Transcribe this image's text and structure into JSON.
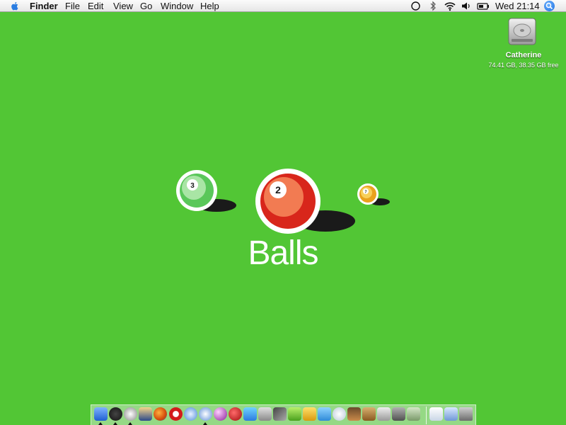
{
  "menubar": {
    "app_name": "Finder",
    "menus": [
      "File",
      "Edit",
      "View",
      "Go",
      "Window",
      "Help"
    ],
    "clock": "Wed 21:14",
    "status_icons": [
      "circle-status-icon",
      "bluetooth-icon",
      "wifi-icon",
      "volume-icon",
      "battery-icon"
    ]
  },
  "desktop": {
    "drive": {
      "name": "Catherine",
      "info": "74.41 GB, 38.35 GB free"
    }
  },
  "logo": {
    "word": "Balls",
    "balls": [
      {
        "number": "3",
        "color": "#7ed67a"
      },
      {
        "number": "2",
        "color": "#e8452a"
      },
      {
        "number": "7",
        "color": "#f1b52a"
      }
    ]
  },
  "dock": {
    "icons": [
      "finder-icon",
      "dashboard-icon",
      "sync-icon",
      "mail-icon",
      "firefox-icon",
      "opera-icon",
      "safari-icon",
      "camino-icon",
      "orb-icon",
      "ruby-icon",
      "messenger-icon",
      "sidebar-app-icon",
      "pen-app-icon",
      "y-app-icon",
      "p-app-icon",
      "u-app-icon",
      "itunes-icon",
      "photo-app-icon",
      "notebook-icon",
      "system-prefs-icon",
      "stuffit-icon",
      "utility-icon",
      "documents-folder-icon",
      "applications-folder-icon",
      "trash-icon"
    ]
  },
  "colors": {
    "desktop_bg": "#52c635",
    "ball_green": "#7ed67a",
    "ball_red": "#e8452a",
    "ball_yellow": "#f1b52a"
  }
}
